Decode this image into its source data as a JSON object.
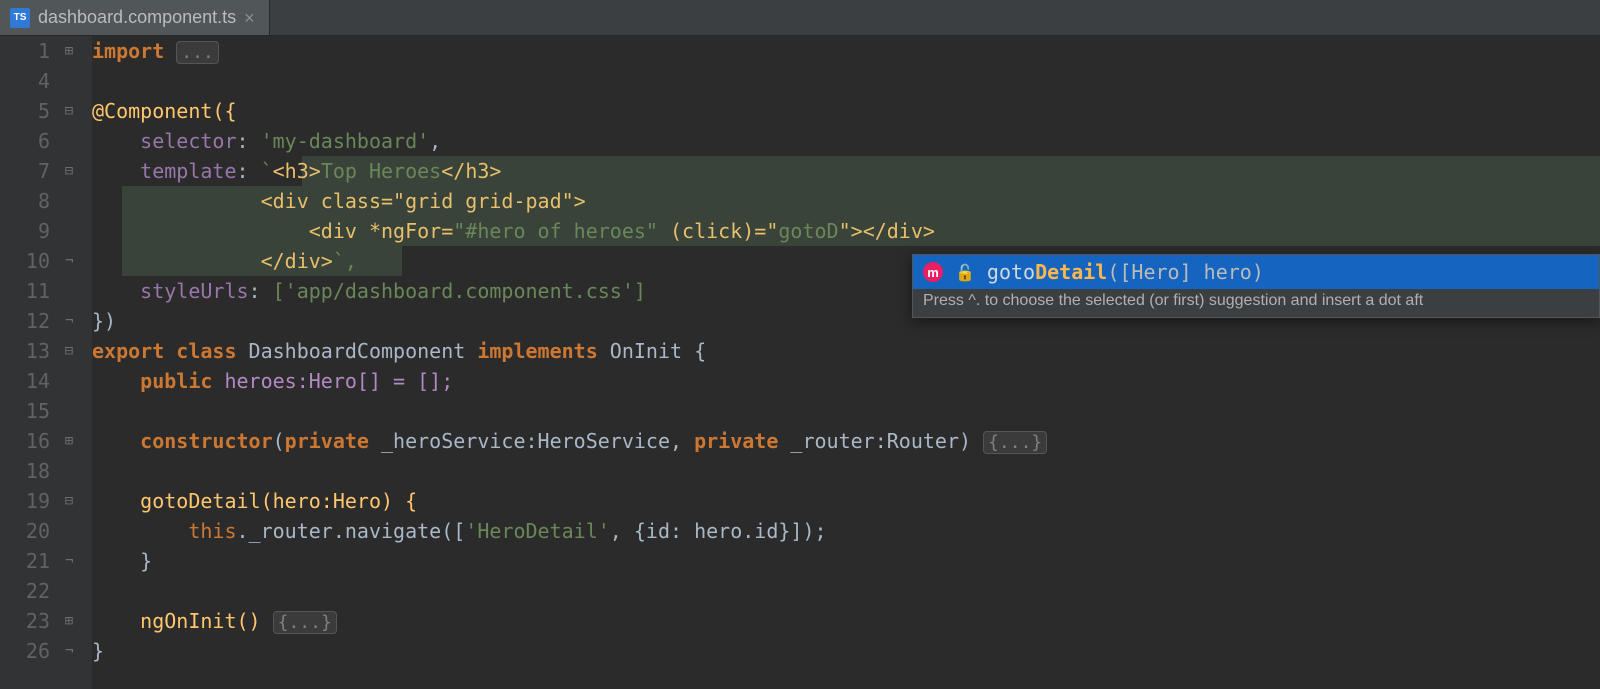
{
  "tab": {
    "filename": "dashboard.component.ts",
    "filetype": "TS"
  },
  "gutter": {
    "lines": [
      1,
      4,
      5,
      6,
      7,
      8,
      9,
      10,
      11,
      12,
      13,
      14,
      15,
      16,
      18,
      19,
      20,
      21,
      22,
      23,
      26
    ]
  },
  "code": {
    "line1_kw": "import ",
    "line1_folded": "...",
    "line5": "@Component({",
    "line6_key": "selector",
    "line6_val": "'my-dashboard'",
    "line7_key": "template",
    "line7_val_prefix": "`",
    "line7_tag": "<h3>",
    "line7_text": "Top Heroes",
    "line7_tagclose": "</h3>",
    "line8": "<div class=\"grid grid-pad\">",
    "line9_a": "<div *ngFor=",
    "line9_b": "\"#hero of heroes\"",
    "line9_c": " (click)=\"",
    "line9_expr": "gotoD",
    "line9_d": "\">",
    "line9_close": "</div>",
    "line10": "</div>",
    "line10_suffix": "`,",
    "line11_key": "styleUrls",
    "line11_val": "['app/dashboard.component.css']",
    "line12": "})",
    "line13_export": "export ",
    "line13_class": "class ",
    "line13_name": "DashboardComponent ",
    "line13_impl": "implements ",
    "line13_iface": "OnInit ",
    "line14_public": "public ",
    "line14_rest": "heroes:Hero[] = [];",
    "line16_ctor": "constructor",
    "line16_open": "(",
    "line16_p1": "private ",
    "line16_p1rest": "_heroService:HeroService, ",
    "line16_p2": "private ",
    "line16_p2rest": "_router:Router) ",
    "line16_folded": "{...}",
    "line19": "gotoDetail(hero:Hero) {",
    "line20_this": "this",
    "line20_rest": "._router.navigate([",
    "line20_str": "'HeroDetail'",
    "line20_end": ", {id: hero.id}]);",
    "line21": "}",
    "line23_name": "ngOnInit() ",
    "line23_folded": "{...}",
    "line26": "}"
  },
  "popup": {
    "badge": "m",
    "prefix": "goto",
    "match": "Detail",
    "sig": "([Hero] hero)",
    "hint": "Press ^. to choose the selected (or first) suggestion and insert a dot aft"
  }
}
